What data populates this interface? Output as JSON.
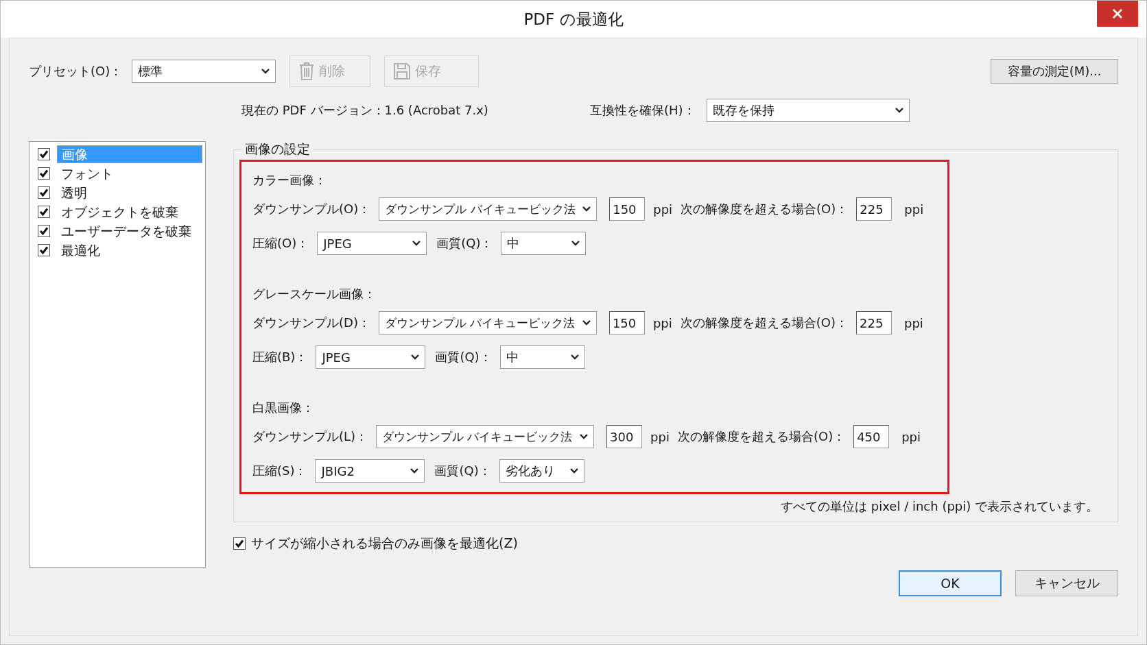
{
  "window": {
    "title": "PDF の最適化"
  },
  "preset": {
    "label": "プリセット(O)：",
    "value": "標準"
  },
  "toolbar_buttons": [
    {
      "kind": "trash",
      "label": "削除",
      "disabled": true
    },
    {
      "kind": "floppy",
      "label": "保存",
      "disabled": true
    }
  ],
  "measure_button": {
    "label": "容量の測定(M)..."
  },
  "pdf_version": "現在の PDF バージョン：1.6 (Acrobat 7.x)",
  "compatibility": {
    "label": "互換性を確保(H)：",
    "value": "既存を保持"
  },
  "categories": [
    {
      "label": "画像",
      "checked": true,
      "selected": true
    },
    {
      "label": "フォント",
      "checked": true,
      "selected": false
    },
    {
      "label": "透明",
      "checked": true,
      "selected": false
    },
    {
      "label": "オブジェクトを破棄",
      "checked": true,
      "selected": false
    },
    {
      "label": "ユーザーデータを破棄",
      "checked": true,
      "selected": false
    },
    {
      "label": "最適化",
      "checked": true,
      "selected": false
    }
  ],
  "image_settings": {
    "title": "画像の設定",
    "highlighted": true,
    "sections": [
      {
        "title": "カラー画像：",
        "downsample_label": "ダウンサンプル(O)：",
        "downsample": "ダウンサンプル バイキュービック法",
        "resolution": "150",
        "resolution_unit": "ppi",
        "threshold_label": "次の解像度を超える場合(O)：",
        "threshold": "225",
        "threshold_unit": "ppi",
        "compression_label": "圧縮(O)：",
        "compression": "JPEG",
        "quality_label": "画質(Q)：",
        "quality": "中"
      },
      {
        "title": "グレースケール画像：",
        "downsample_label": "ダウンサンプル(D)：",
        "downsample": "ダウンサンプル バイキュービック法",
        "resolution": "150",
        "resolution_unit": "ppi",
        "threshold_label": "次の解像度を超える場合(O)：",
        "threshold": "225",
        "threshold_unit": "ppi",
        "compression_label": "圧縮(B)：",
        "compression": "JPEG",
        "quality_label": "画質(Q)：",
        "quality": "中"
      },
      {
        "title": "白黒画像：",
        "downsample_label": "ダウンサンプル(L)：",
        "downsample": "ダウンサンプル バイキュービック法",
        "resolution": "300",
        "resolution_unit": "ppi",
        "threshold_label": "次の解像度を超える場合(O)：",
        "threshold": "450",
        "threshold_unit": "ppi",
        "compression_label": "圧縮(S)：",
        "compression": "JBIG2",
        "quality_label": "画質(Q)：",
        "quality": "劣化あり"
      }
    ],
    "note": "すべての単位は pixel / inch (ppi) で表示されています。"
  },
  "optimize_only_smaller": {
    "label": "サイズが縮小される場合のみ画像を最適化(Z)",
    "checked": true
  },
  "buttons": [
    {
      "label": "OK",
      "default": true
    },
    {
      "label": "キャンセル",
      "default": false
    }
  ]
}
